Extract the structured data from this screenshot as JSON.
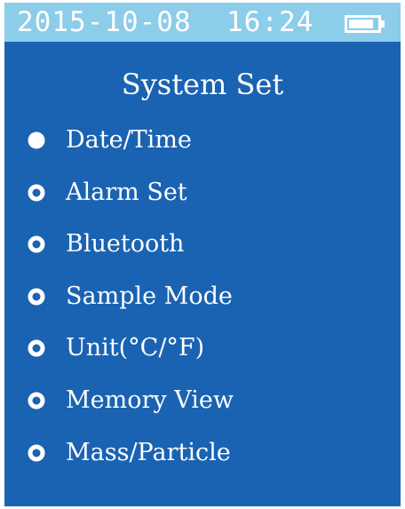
{
  "status_bar": {
    "datetime": "2015-10-08  16:24",
    "battery_icon": "battery-icon"
  },
  "screen": {
    "title": "System Set"
  },
  "menu": {
    "items": [
      {
        "label": "Date/Time",
        "selected": true
      },
      {
        "label": "Alarm Set",
        "selected": false
      },
      {
        "label": "Bluetooth",
        "selected": false
      },
      {
        "label": "Sample Mode",
        "selected": false
      },
      {
        "label": "Unit(°C/°F)",
        "selected": false
      },
      {
        "label": "Memory View",
        "selected": false
      },
      {
        "label": "Mass/Particle",
        "selected": false
      }
    ]
  },
  "colors": {
    "background": "#1a63b2",
    "status_bar": "#8ccde9",
    "text": "#ffffff"
  }
}
